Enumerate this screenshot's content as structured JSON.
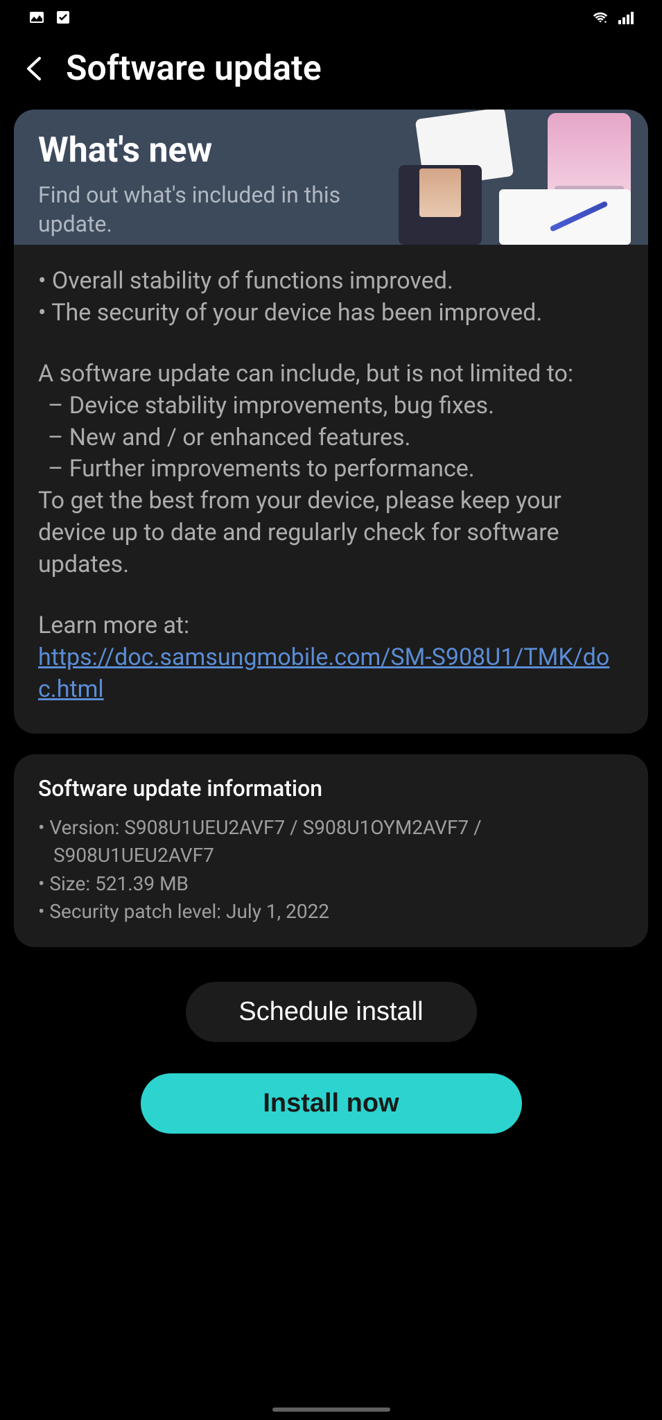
{
  "status_bar": {
    "icons_left": [
      "picture",
      "checkbox"
    ],
    "icons_right": [
      "wifi",
      "signal"
    ]
  },
  "header": {
    "title": "Software update"
  },
  "hero": {
    "title": "What's new",
    "subtitle": "Find out what's included in this update."
  },
  "content": {
    "bullets": [
      "Overall stability of functions improved.",
      "The security of your device has been improved."
    ],
    "intro": "A software update can include, but is not limited to:",
    "items": [
      "Device stability improvements, bug fixes.",
      "New and / or enhanced features.",
      "Further improvements to performance."
    ],
    "advice": "To get the best from your device, please keep your device up to date and regularly check for software updates.",
    "learn_label": "Learn more at:",
    "learn_url": "https://doc.samsungmobile.com/SM-S908U1/TMK/doc.html"
  },
  "info": {
    "title": "Software update information",
    "version_label": "Version: ",
    "version": "S908U1UEU2AVF7 / S908U1OYM2AVF7 / S908U1UEU2AVF7",
    "size_label": "Size: ",
    "size": "521.39 MB",
    "patch_label": "Security patch level: ",
    "patch": "July 1, 2022"
  },
  "buttons": {
    "schedule": "Schedule install",
    "install": "Install now"
  }
}
